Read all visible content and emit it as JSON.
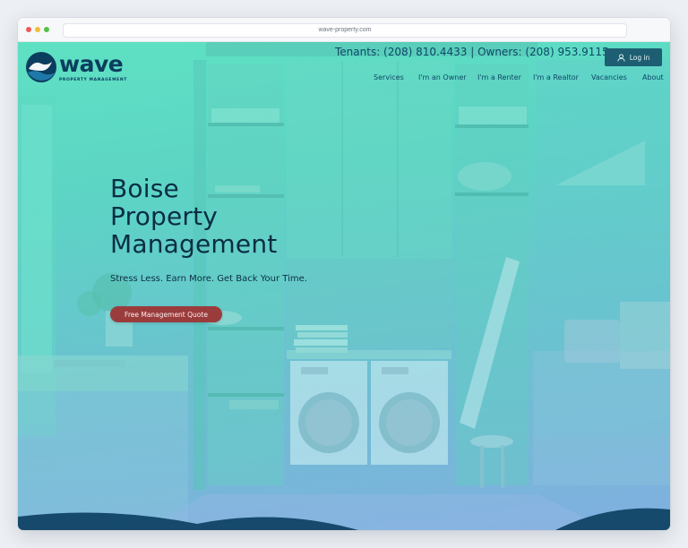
{
  "browser": {
    "url": "wave-property.com"
  },
  "header": {
    "logo_word": "wave",
    "logo_tagline": "PROPERTY MANAGEMENT",
    "phones": "Tenants: (208) 810.4433 | Owners: (208) 953.9115",
    "login_label": "Log in",
    "nav": [
      {
        "label": "Services"
      },
      {
        "label": "I'm an Owner"
      },
      {
        "label": "I'm a Renter"
      },
      {
        "label": "I'm a Realtor"
      },
      {
        "label": "Vacancies"
      },
      {
        "label": "About"
      }
    ]
  },
  "hero": {
    "headline_lines": [
      "Boise",
      "Property",
      "Management"
    ],
    "subheadline": "Stress Less. Earn More. Get Back Your Time.",
    "cta_label": "Free Management Quote"
  },
  "colors": {
    "brand_navy": "#0b3d5e",
    "accent_teal": "#5fe0c2",
    "cta_red": "#9b3c3c",
    "login_teal": "#1e5e73"
  },
  "icons": {
    "login": "user-icon",
    "logo": "wave-icon"
  }
}
